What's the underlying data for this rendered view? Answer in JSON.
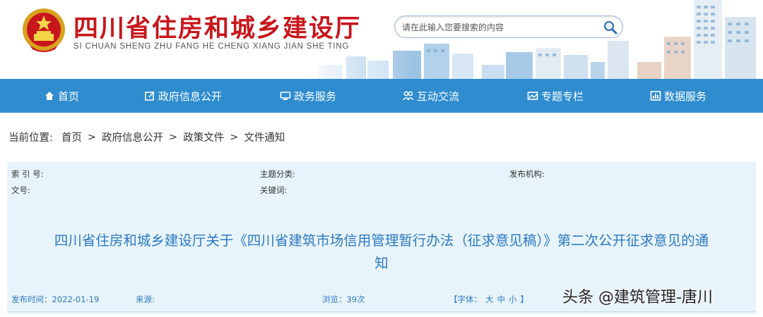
{
  "header": {
    "title": "四川省住房和城乡建设厅",
    "subtitle": "SI CHUAN SHENG ZHU FANG HE CHENG XIANG JIAN SHE TING",
    "emblem_icon": "national-emblem-icon"
  },
  "search": {
    "placeholder": "请在此输入您要搜索的内容",
    "icon": "search-icon"
  },
  "nav": {
    "items": [
      {
        "label": "首页",
        "icon": "home-icon"
      },
      {
        "label": "政府信息公开",
        "icon": "edit-icon"
      },
      {
        "label": "政务服务",
        "icon": "monitor-icon"
      },
      {
        "label": "互动交流",
        "icon": "people-icon"
      },
      {
        "label": "专题专栏",
        "icon": "image-icon"
      },
      {
        "label": "数据服务",
        "icon": "chart-icon"
      }
    ]
  },
  "breadcrumb": {
    "label": "当前位置:",
    "items": [
      "首页",
      "政府信息公开",
      "政策文件",
      "文件通知"
    ],
    "separator": ">"
  },
  "meta": {
    "index_no_label": "索 引 号:",
    "topic_label": "主题分类:",
    "publisher_label": "发布机构:",
    "doc_no_label": "文号:",
    "keywords_label": "关键词:"
  },
  "document": {
    "title_line1": "四川省住房和城乡建设厅关于《四川省建筑市场信用管理暂行办法（征求意见稿）》第二次公开征求意见的通",
    "title_line2": "知"
  },
  "info_bar": {
    "publish_time": "发布时间：2022-01-19",
    "source": "来源:",
    "views": "浏览：39次",
    "font_label": "【字体：",
    "font_large": "大",
    "font_medium": "中",
    "font_small": "小",
    "font_close": "】"
  },
  "watermark": "头条 @建筑管理-唐川",
  "colors": {
    "brand_red": "#c8161d",
    "nav_blue": "#2e8ccf",
    "title_blue": "#2b7ac0",
    "meta_bg": "#e8f4fb"
  }
}
